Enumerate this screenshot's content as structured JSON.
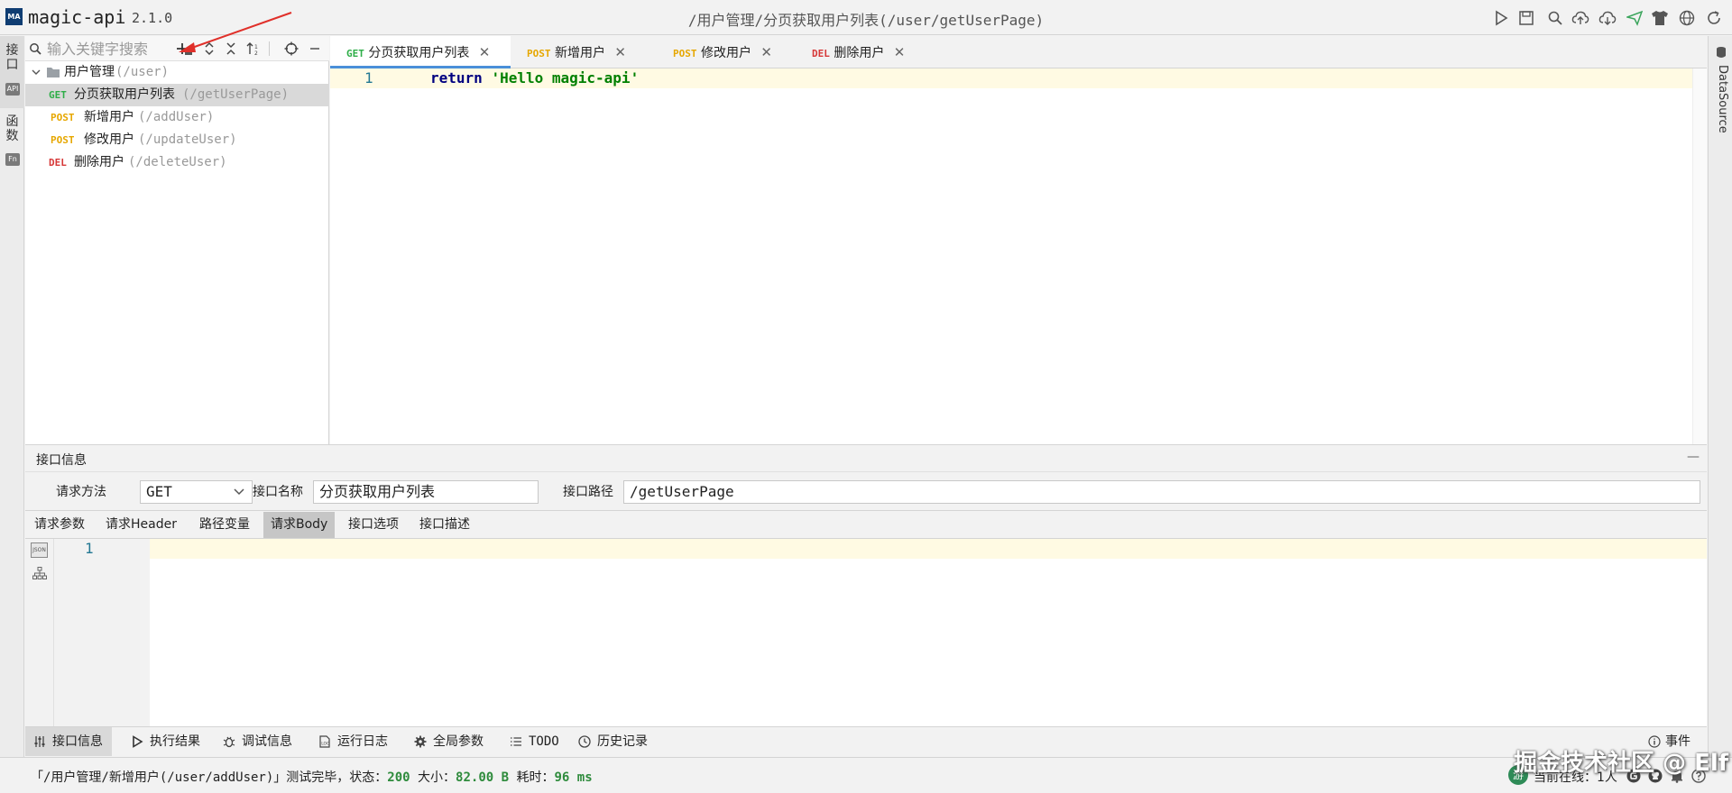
{
  "app": {
    "name": "magic-api",
    "version": "2.1.0",
    "logo": "MA",
    "title_path": "/用户管理/分页获取用户列表(/user/getUserPage)"
  },
  "toolbar_icons": [
    "run-icon",
    "save-icon",
    "search-icon",
    "upload-icon",
    "download-icon",
    "send-icon",
    "skin-icon",
    "globe-icon",
    "refresh-icon"
  ],
  "left_strip": {
    "api_tab": "接口",
    "func_tab": "函数",
    "api_badge": "API",
    "fn_badge": "Fn"
  },
  "right_strip": {
    "datasource": "DataSource"
  },
  "tree": {
    "search_placeholder": "输入关键字搜索",
    "group": {
      "name": "用户管理",
      "path": "(/user)"
    },
    "items": [
      {
        "method": "GET",
        "name": "分页获取用户列表",
        "path": "(/getUserPage)"
      },
      {
        "method": "POST",
        "name": "新增用户",
        "path": "(/addUser)"
      },
      {
        "method": "POST",
        "name": "修改用户",
        "path": "(/updateUser)"
      },
      {
        "method": "DEL",
        "name": "删除用户",
        "path": "(/deleteUser)"
      }
    ]
  },
  "tabs": [
    {
      "method": "GET",
      "name": "分页获取用户列表"
    },
    {
      "method": "POST",
      "name": "新增用户"
    },
    {
      "method": "POST",
      "name": "修改用户"
    },
    {
      "method": "DEL",
      "name": "删除用户"
    }
  ],
  "editor": {
    "line": "1",
    "keyword": "return",
    "string": "'Hello magic-api'"
  },
  "info": {
    "title": "接口信息",
    "collapse": "—",
    "method_label": "请求方法",
    "method_value": "GET",
    "name_label": "接口名称",
    "name_value": "分页获取用户列表",
    "path_label": "接口路径",
    "path_value": "/getUserPage"
  },
  "subtabs": [
    "请求参数",
    "请求Header",
    "路径变量",
    "请求Body",
    "接口选项",
    "接口描述"
  ],
  "body_editor": {
    "line": "1",
    "json_badge": "JSON"
  },
  "bottom_tabs": [
    "接口信息",
    "执行结果",
    "调试信息",
    "运行日志",
    "全局参数",
    "TODO",
    "历史记录"
  ],
  "events_label": "事件",
  "status": {
    "prefix": "「/用户管理/新增用户(/user/addUser)」测试完毕，状态：",
    "code": "200",
    "size_label": "大小：",
    "size": "82.00 B",
    "time_label": "耗时：",
    "time": "96 ms",
    "online_badge": "游",
    "online": "当前在线：1人"
  },
  "watermark": "掘金技术社区 @ Elf",
  "colors": {
    "get": "#2eae48",
    "post": "#e6a700",
    "del": "#d63838",
    "active_tab_line": "#4a90d9",
    "line_highlight": "#fffae3",
    "keyword": "#000080",
    "string": "#008000"
  }
}
